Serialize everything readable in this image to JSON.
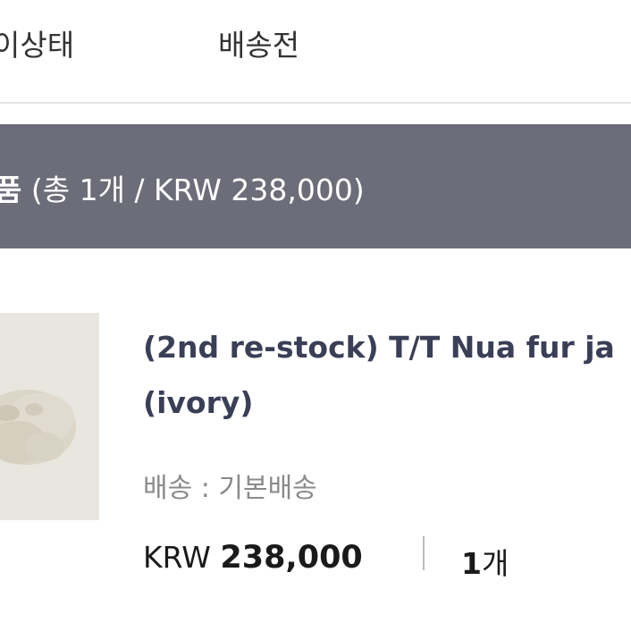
{
  "status_row": {
    "left_label": "이상태",
    "right_label": "배송전"
  },
  "order_bar": {
    "label_strong": "품",
    "summary": " (총 1개 / KRW 238,000)"
  },
  "product": {
    "image_name": "ivory fur jacket photo",
    "name_line1": "(2nd re-stock) T/T Nua fur ja",
    "name_line2": "(ivory)",
    "shipping": "배송 : 기본배송",
    "price_currency": "KRW ",
    "price_amount": "238,000",
    "quantity_number": "1",
    "quantity_unit": "개"
  },
  "colors": {
    "bar_background": "#6c6d78",
    "product_name": "#3a3f57",
    "muted_text": "#8a8a8a"
  }
}
